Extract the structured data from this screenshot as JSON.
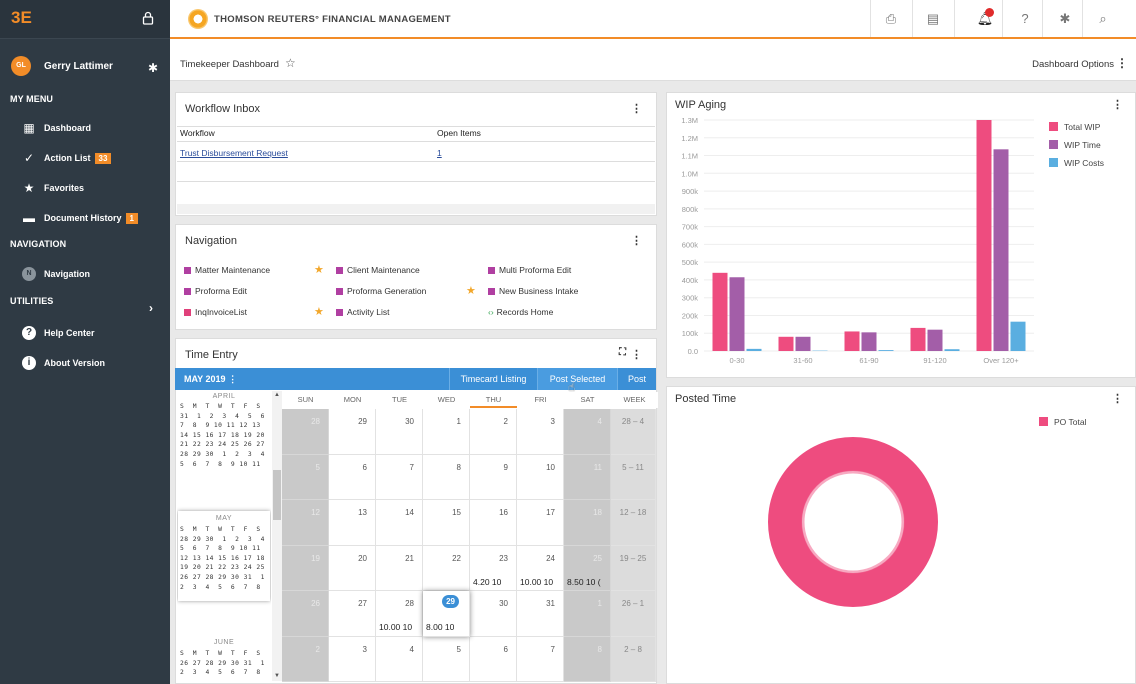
{
  "sidebar": {
    "logo": "3E",
    "user": {
      "initials": "GL",
      "name": "Gerry Lattimer"
    },
    "sections": {
      "my_menu": "MY MENU",
      "navigation": "NAVIGATION",
      "utilities": "UTILITIES"
    },
    "items": [
      {
        "label": "Dashboard",
        "icon": "dashboard-icon"
      },
      {
        "label": "Action List",
        "icon": "check-icon",
        "badge": "33"
      },
      {
        "label": "Favorites",
        "icon": "star-icon"
      },
      {
        "label": "Document History",
        "icon": "folder-icon",
        "badge": "1"
      },
      {
        "label": "Navigation",
        "icon": "navigation-icon"
      },
      {
        "label": "Help Center",
        "icon": "help-icon"
      },
      {
        "label": "About Version",
        "icon": "info-icon"
      }
    ]
  },
  "topbar": {
    "title": "THOMSON REUTERS° FINANCIAL MANAGEMENT",
    "icons": [
      "print-icon",
      "document-icon",
      "bell-icon",
      "help-icon",
      "gear-icon",
      "search-icon"
    ]
  },
  "dashboard": {
    "title": "Timekeeper Dashboard",
    "options": "Dashboard Options"
  },
  "workflow": {
    "title": "Workflow Inbox",
    "columns": [
      "Workflow",
      "Open Items"
    ],
    "rows": [
      {
        "name": "Trust Disbursement Request",
        "count": "1"
      }
    ]
  },
  "navigation": {
    "title": "Navigation",
    "links": [
      {
        "label": "Matter Maintenance",
        "star": true
      },
      {
        "label": "Client Maintenance",
        "star": false
      },
      {
        "label": "Multi Proforma Edit",
        "star": false
      },
      {
        "label": "Proforma Edit",
        "star": false
      },
      {
        "label": "Proforma Generation",
        "star": true
      },
      {
        "label": "New Business Intake",
        "star": false
      },
      {
        "label": "InqInvoiceList",
        "star": true
      },
      {
        "label": "Activity List",
        "star": false
      },
      {
        "label": "Records Home",
        "star": false
      }
    ]
  },
  "time_entry": {
    "title": "Time Entry",
    "month": "MAY  2019",
    "buttons": [
      "Timecard Listing",
      "Post Selected",
      "Post"
    ],
    "day_headers": [
      "SUN",
      "MON",
      "TUE",
      "WED",
      "THU",
      "FRI",
      "SAT",
      "WEEK"
    ],
    "weeks": [
      {
        "days": [
          "28",
          "29",
          "30",
          "1",
          "2",
          "3",
          "4"
        ],
        "range": "28 – 4"
      },
      {
        "days": [
          "5",
          "6",
          "7",
          "8",
          "9",
          "10",
          "11"
        ],
        "range": "5 – 11"
      },
      {
        "days": [
          "12",
          "13",
          "14",
          "15",
          "16",
          "17",
          "18"
        ],
        "range": "12 – 18"
      },
      {
        "days": [
          "19",
          "20",
          "21",
          "22",
          "23",
          "24",
          "25"
        ],
        "range": "19 – 25"
      },
      {
        "days": [
          "26",
          "27",
          "28",
          "29",
          "30",
          "31",
          "1"
        ],
        "range": "26 – 1"
      },
      {
        "days": [
          "2",
          "3",
          "4",
          "5",
          "6",
          "7",
          "8"
        ],
        "range": "2 – 8"
      }
    ],
    "hours": {
      "w3d4": "4.20 10",
      "w3d5": "10.00 10",
      "w3d6": "8.50 10 (",
      "w4d2": "10.00 10",
      "w4d3": "8.00 10"
    },
    "mini": {
      "april": {
        "name": "APRIL",
        "rows": [
          "S  M  T  W  T  F  S",
          "31  1  2  3  4  5  6",
          "7  8  9 10 11 12 13",
          "14 15 16 17 18 19 20",
          "21 22 23 24 25 26 27",
          "28 29 30  1  2  3  4",
          "5  6  7  8  9 10 11"
        ]
      },
      "may": {
        "name": "MAY",
        "rows": [
          "S  M  T  W  T  F  S",
          "28 29 30  1  2  3  4",
          "5  6  7  8  9 10 11",
          "12 13 14 15 16 17 18",
          "19 20 21 22 23 24 25",
          "26 27 28 29 30 31  1",
          "2  3  4  5  6  7  8"
        ]
      },
      "june": {
        "name": "JUNE",
        "rows": [
          "S  M  T  W  T  F  S",
          "26 27 28 29 30 31  1",
          "2  3  4  5  6  7  8"
        ]
      }
    }
  },
  "wip_aging": {
    "title": "WIP Aging"
  },
  "posted_time": {
    "title": "Posted Time"
  },
  "chart_data": [
    {
      "type": "bar",
      "title": "WIP Aging",
      "categories": [
        "0-30",
        "31-60",
        "61-90",
        "91-120",
        "Over 120+"
      ],
      "series": [
        {
          "name": "Total WIP",
          "color": "#ee4c7f",
          "values": [
            440000,
            80000,
            110000,
            130000,
            1300000
          ]
        },
        {
          "name": "WIP Time",
          "color": "#a35ea8",
          "values": [
            415000,
            80000,
            105000,
            120000,
            1135000
          ]
        },
        {
          "name": "WIP Costs",
          "color": "#5aaee0",
          "values": [
            12000,
            2000,
            5000,
            10000,
            165000
          ]
        }
      ],
      "yticks": [
        "0.0",
        "100k",
        "200k",
        "300k",
        "400k",
        "500k",
        "600k",
        "700k",
        "800k",
        "900k",
        "1.0M",
        "1.1M",
        "1.2M",
        "1.3M"
      ],
      "ylim": [
        0,
        1300000
      ],
      "legend": "top-right"
    },
    {
      "type": "pie",
      "title": "Posted Time",
      "series": [
        {
          "name": "PO Total",
          "color": "#ee4c7f",
          "values": [
            100
          ]
        }
      ],
      "legend": "top-right"
    }
  ]
}
